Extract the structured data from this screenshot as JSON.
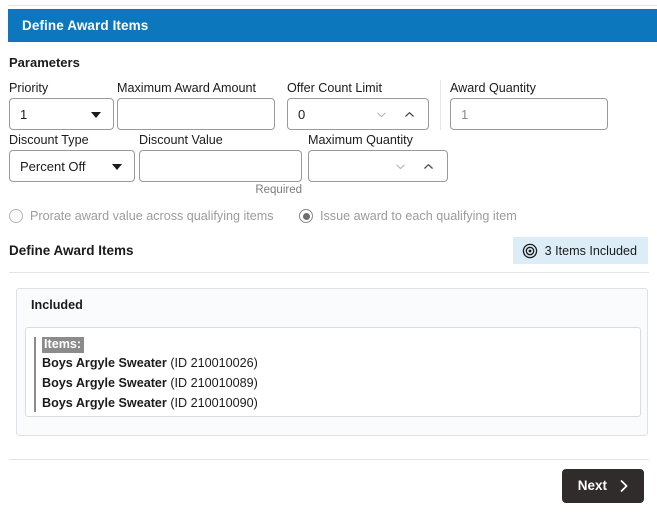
{
  "window": {
    "title": "Define Award Items"
  },
  "colors": {
    "header_blue": "#0c77bd",
    "badge_bg": "#dcedf7",
    "button_dark": "#2f2c2b",
    "border_gray": "#9a9a9a",
    "muted_text": "#9c9c9c"
  },
  "parameters": {
    "heading": "Parameters",
    "fields": [
      {
        "label": "Priority",
        "value": "1",
        "type": "select",
        "placeholder": ""
      },
      {
        "label": "Maximum Award Amount",
        "value": "",
        "type": "text",
        "placeholder": ""
      },
      {
        "label": "Offer Count Limit",
        "value": "0",
        "type": "spinner",
        "placeholder": ""
      },
      {
        "label": "Award Quantity",
        "value": "1",
        "type": "text",
        "placeholder": ""
      },
      {
        "label": "Discount Type",
        "value": "Percent Off",
        "type": "select",
        "placeholder": ""
      },
      {
        "label": "Discount Value",
        "value": "",
        "type": "text",
        "placeholder": "",
        "helper": "Required"
      },
      {
        "label": "Maximum Quantity",
        "value": "",
        "type": "spinner",
        "placeholder": ""
      }
    ]
  },
  "award_options": {
    "prorate": {
      "label": "Prorate award value across qualifying items",
      "selected": false
    },
    "each": {
      "label": "Issue award to each qualifying item",
      "selected": true
    }
  },
  "award_items": {
    "heading": "Define Award Items",
    "badge": {
      "icon": "target-icon",
      "label": "3 Items Included"
    },
    "panel_title": "Included",
    "list_label": "Items:",
    "items": [
      {
        "name": "Boys Argyle Sweater",
        "id": "(ID 210010026)"
      },
      {
        "name": "Boys Argyle Sweater",
        "id": "(ID 210010089)"
      },
      {
        "name": "Boys Argyle Sweater",
        "id": "(ID 210010090)"
      }
    ]
  },
  "footer": {
    "next_label": "Next",
    "next_icon": "chevron-right-icon"
  }
}
